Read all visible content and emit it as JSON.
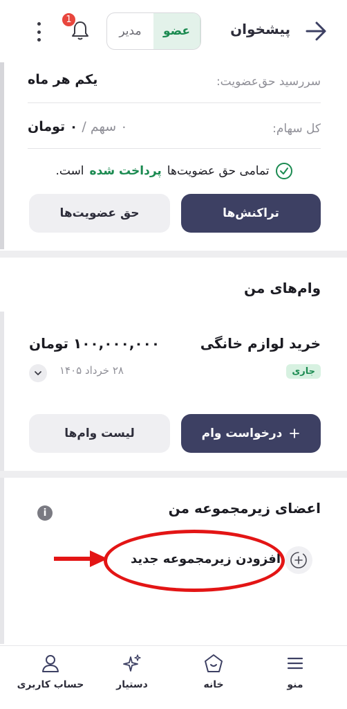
{
  "header": {
    "title": "پیشخوان",
    "role_manager": "مدیر",
    "role_member": "عضو",
    "notification_count": "1"
  },
  "membership": {
    "due_label": "سررسید حق‌عضویت:",
    "due_value": "یکم هر ماه",
    "shares_label": "کل سهام:",
    "shares_count": "۰ سهم",
    "shares_sep": " / ",
    "shares_amount": "۰ تومان",
    "paid_prefix": "تمامی حق عضویت‌ها",
    "paid_status": "پرداخت شده",
    "paid_suffix": "است.",
    "btn_transactions": "تراکنش‌ها",
    "btn_fees": "حق عضویت‌ها"
  },
  "loans": {
    "title": "وام‌های من",
    "items": [
      {
        "name": "خرید لوازم خانگی",
        "amount": "۱۰۰,۰۰۰,۰۰۰ تومان",
        "status": "جاری",
        "date": "۲۸ خرداد ۱۴۰۵"
      }
    ],
    "btn_request": "درخواست وام",
    "btn_list": "لیست وام‌ها"
  },
  "subgroup": {
    "title": "اعضای زیرمجموعه من",
    "info": "i",
    "add_label": "افزودن زیرمجموعه جدید"
  },
  "bottom_nav": {
    "menu": "منو",
    "home": "خانه",
    "assistant": "دستیار",
    "account": "حساب کاربری"
  },
  "colors": {
    "primary": "#3d4063",
    "success": "#1a8a50",
    "annotation": "#e31515",
    "badge": "#e8463d"
  },
  "icons": [
    "back-arrow-icon",
    "bell-icon",
    "kebab-menu-icon",
    "check-circle-icon",
    "plus-icon",
    "chevron-down-icon",
    "info-icon",
    "add-circle-icon",
    "menu-icon",
    "home-icon",
    "sparkle-icon",
    "user-icon"
  ]
}
